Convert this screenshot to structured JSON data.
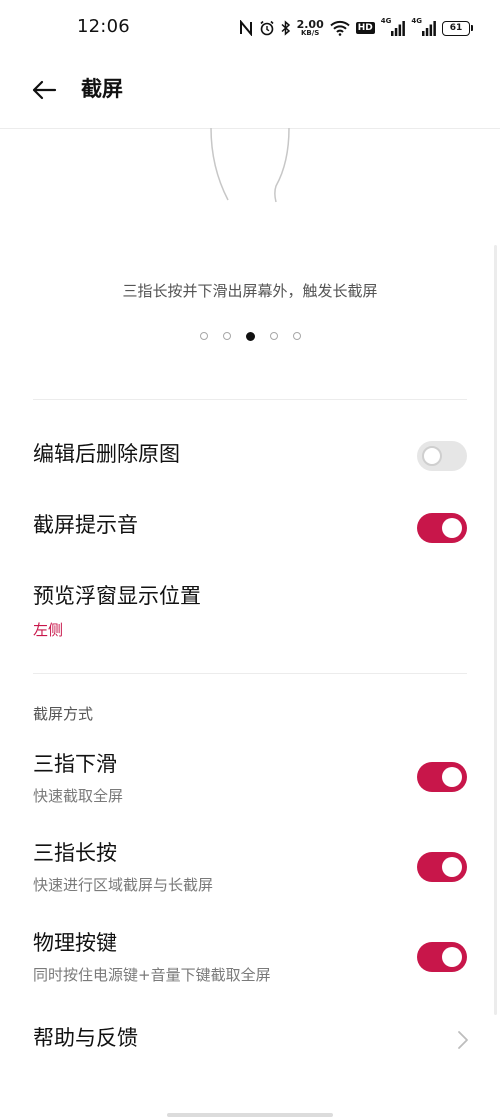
{
  "status_bar": {
    "time": "12:06",
    "net_speed_value": "2.00",
    "net_speed_unit": "KB/S",
    "hd_label": "HD",
    "signal1_label": "4G",
    "signal2_label": "4G",
    "battery": "61"
  },
  "header": {
    "title": "截屏"
  },
  "tutorial": {
    "caption": "三指长按并下滑出屏幕外，触发长截屏",
    "page_count": 5,
    "active_page": 3
  },
  "settings": {
    "delete_after_edit": {
      "label": "编辑后删除原图",
      "enabled": false
    },
    "screenshot_sound": {
      "label": "截屏提示音",
      "enabled": true
    },
    "preview_position": {
      "label": "预览浮窗显示位置",
      "value": "左侧"
    }
  },
  "methods": {
    "section_title": "截屏方式",
    "three_finger_swipe": {
      "label": "三指下滑",
      "description": "快速截取全屏",
      "enabled": true
    },
    "three_finger_hold": {
      "label": "三指长按",
      "description": "快速进行区域截屏与长截屏",
      "enabled": true
    },
    "physical_keys": {
      "label": "物理按键",
      "description": "同时按住电源键+音量下键截取全屏",
      "enabled": true
    }
  },
  "help": {
    "label": "帮助与反馈"
  },
  "colors": {
    "accent": "#c8164a",
    "toggle_off": "#e6e6e6"
  }
}
